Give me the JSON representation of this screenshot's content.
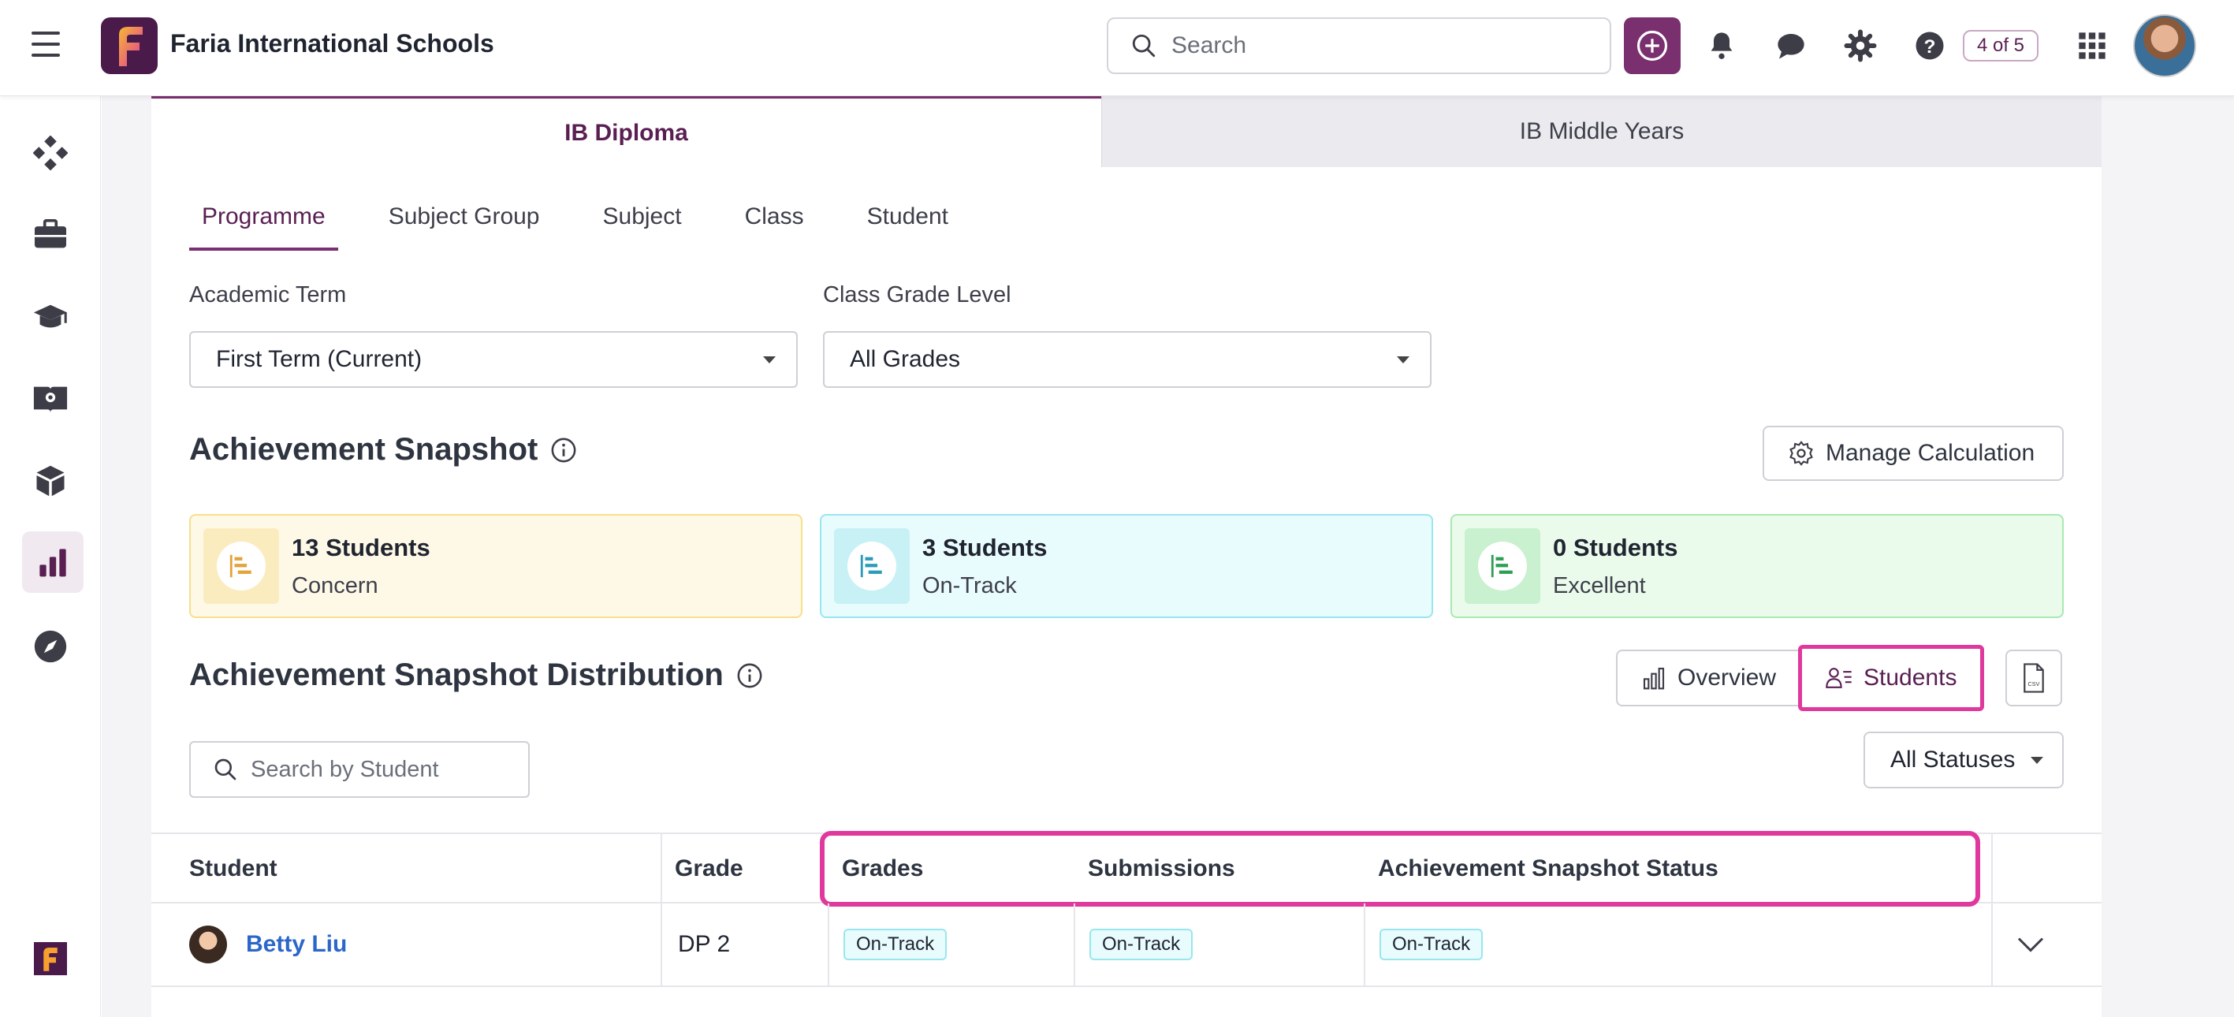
{
  "app": {
    "school_name": "Faria International Schools",
    "search_placeholder": "Search",
    "counter_label": "4 of 5",
    "brand_color": "#5a1f52",
    "accent_color": "#7a2f6e",
    "highlight_color": "#e0399d"
  },
  "sidebar": {
    "items": [
      {
        "icon": "dashboard-icon"
      },
      {
        "icon": "briefcase-icon"
      },
      {
        "icon": "graduation-cap-icon"
      },
      {
        "icon": "book-icon"
      },
      {
        "icon": "cube-icon"
      },
      {
        "icon": "bar-chart-icon",
        "active": true
      },
      {
        "icon": "compass-icon"
      }
    ],
    "bottom_logo": "faria-logo-icon"
  },
  "programme_tabs": [
    {
      "label": "IB Diploma",
      "active": true
    },
    {
      "label": "IB Middle Years",
      "active": false
    }
  ],
  "sub_tabs": [
    {
      "label": "Programme",
      "active": true
    },
    {
      "label": "Subject Group"
    },
    {
      "label": "Subject"
    },
    {
      "label": "Class"
    },
    {
      "label": "Student"
    }
  ],
  "filters": {
    "academic_term": {
      "label": "Academic Term",
      "value": "First Term (Current)"
    },
    "grade_level": {
      "label": "Class Grade Level",
      "value": "All Grades"
    }
  },
  "snapshot": {
    "title": "Achievement Snapshot",
    "manage_button": "Manage Calculation",
    "cards": [
      {
        "count": "13 Students",
        "label": "Concern",
        "color": "#e2a33a"
      },
      {
        "count": "3 Students",
        "label": "On-Track",
        "color": "#2a9bb8"
      },
      {
        "count": "0 Students",
        "label": "Excellent",
        "color": "#2e9e56"
      }
    ]
  },
  "distribution": {
    "title": "Achievement Snapshot Distribution",
    "overview_button": "Overview",
    "students_button": "Students",
    "search_placeholder": "Search by Student",
    "status_filter": "All Statuses"
  },
  "table": {
    "headers": [
      "Student",
      "Grade",
      "Grades",
      "Submissions",
      "Achievement Snapshot Status"
    ],
    "rows": [
      {
        "student": "Betty Liu",
        "grade": "DP 2",
        "grades": "On-Track",
        "submissions": "On-Track",
        "status": "On-Track"
      }
    ]
  }
}
